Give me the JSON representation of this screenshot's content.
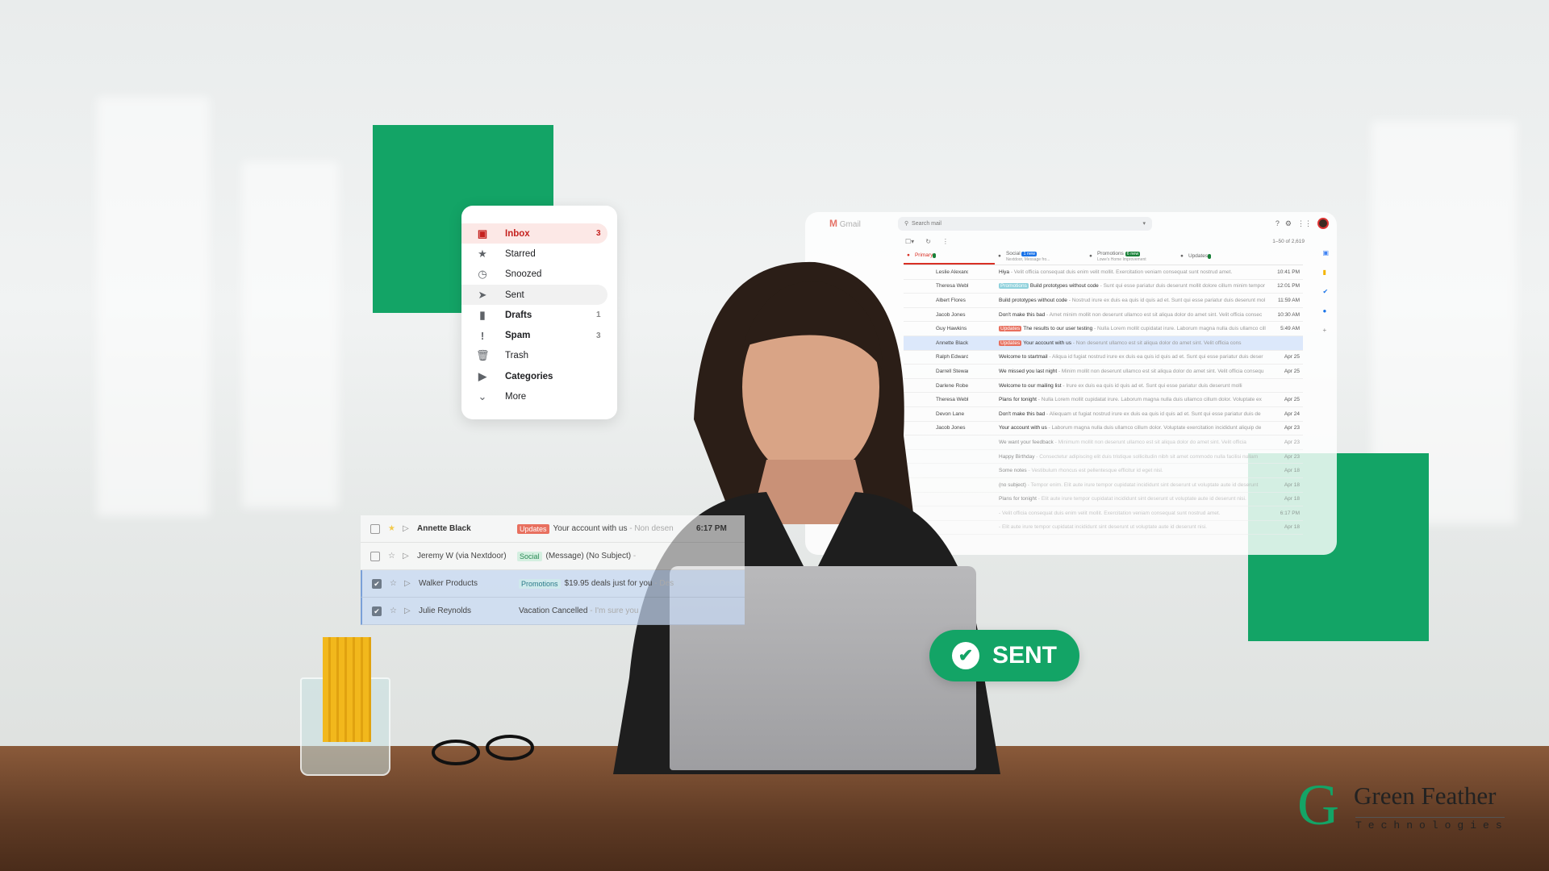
{
  "colors": {
    "brand_green": "#13a466",
    "inbox_red": "#c5221f"
  },
  "nav": {
    "items": [
      {
        "icon": "inbox-icon",
        "label": "Inbox",
        "count": "3"
      },
      {
        "icon": "star-icon",
        "label": "Starred",
        "count": ""
      },
      {
        "icon": "clock-icon",
        "label": "Snoozed",
        "count": ""
      },
      {
        "icon": "send-icon",
        "label": "Sent",
        "count": ""
      },
      {
        "icon": "draft-icon",
        "label": "Drafts",
        "count": "1"
      },
      {
        "icon": "spam-icon",
        "label": "Spam",
        "count": "3"
      },
      {
        "icon": "trash-icon",
        "label": "Trash",
        "count": ""
      },
      {
        "icon": "label-icon",
        "label": "Categories",
        "count": ""
      },
      {
        "icon": "chevron-down-icon",
        "label": "More",
        "count": ""
      }
    ]
  },
  "gmail": {
    "app_name": "Gmail",
    "search_placeholder": "Search mail",
    "pagination": "1–50 of 2,619",
    "tabs": [
      {
        "label": "Primary",
        "badge": "",
        "sub": ""
      },
      {
        "label": "Social",
        "badge": "1 new",
        "sub": "Nextdoor, Message fro..."
      },
      {
        "label": "Promotions",
        "badge": "6 new",
        "sub": "Lowe's Home Improvement"
      },
      {
        "label": "Updates",
        "badge": "",
        "sub": ""
      }
    ],
    "rows": [
      {
        "sender": "Leslie Alexander",
        "tag": "",
        "subject": "Hiya",
        "snippet": " - Velit officia consequat duis enim velit mollit. Exercitation veniam consequat sunt nostrud amet.",
        "time": "10:41 PM"
      },
      {
        "sender": "Theresa Webb",
        "tag": "Promotions",
        "subject": "Build prototypes without code",
        "snippet": " - Sunt qui esse pariatur duis deserunt mollit dolore cillum minim tempor",
        "time": "12:01 PM"
      },
      {
        "sender": "Albert Flores",
        "tag": "",
        "subject": "Build prototypes without code",
        "snippet": " - Nostrud irure ex duis ea quis id quis ad et. Sunt qui esse pariatur duis deserunt mol",
        "time": "11:59 AM"
      },
      {
        "sender": "Jacob Jones",
        "tag": "",
        "subject": "Don't make this bad",
        "snippet": " - Amet minim mollit non deserunt ullamco est sit aliqua dolor do amet sint. Velit officia consec",
        "time": "10:30 AM"
      },
      {
        "sender": "Guy Hawkins",
        "tag": "Updates",
        "subject": "The results to our user testing",
        "snippet": " - Nulla Lorem mollit cupidatat irure. Laborum magna nulla duis ullamco cill",
        "time": "5:49 AM"
      },
      {
        "sender": "Annette Black",
        "tag": "Updates",
        "subject": "Your account with us",
        "snippet": " - Non deserunt ullamco est sit aliqua dolor do amet sint. Velit officia cons",
        "time": ""
      },
      {
        "sender": "Ralph Edwards",
        "tag": "",
        "subject": "Welcome to startmail",
        "snippet": " - Aliqua id fugiat nostrud irure ex duis ea quis id quis ad et. Sunt qui esse pariatur duis deser",
        "time": "Apr 25"
      },
      {
        "sender": "Darrell Steward",
        "tag": "",
        "subject": "We missed you last night",
        "snippet": " - Minim mollit non deserunt ullamco est sit aliqua dolor do amet sint. Velit officia consequ",
        "time": "Apr 25"
      },
      {
        "sender": "Darlene Robertson",
        "tag": "",
        "subject": "Welcome to our mailing list",
        "snippet": " - Irure ex duis ea quis id quis ad et. Sunt qui esse pariatur duis deserunt molli",
        "time": ""
      },
      {
        "sender": "Theresa Webb",
        "tag": "",
        "subject": "Plans for tonight",
        "snippet": " - Nulla Lorem mollit cupidatat irure. Laborum magna nulla duis ullamco cillum dolor. Voluptate ex",
        "time": "Apr 25"
      },
      {
        "sender": "Devon Lane",
        "tag": "",
        "subject": "Don't make this bad",
        "snippet": " - Aliequam ut fugiat nostrud irure ex duis ea quis id quis ad et. Sunt qui esse pariatur duis de",
        "time": "Apr 24"
      },
      {
        "sender": "Jacob Jones",
        "tag": "",
        "subject": "Your account with us",
        "snippet": " - Laborum magna nulla duis ullamco cillum dolor. Voluptate exercitation incididunt aliquip de",
        "time": "Apr 23"
      },
      {
        "sender": "",
        "tag": "",
        "subject": "We want your feedback",
        "snippet": " - Minimum mollit non deserunt ullamco est sit aliqua dolor do amet sint. Velit officia",
        "time": "Apr 23"
      },
      {
        "sender": "",
        "tag": "",
        "subject": "Happy Birthday",
        "snippet": " - Consectetur adipiscing elit duis tristique sollicitudin nibh sit amet commodo nulla facilisi nullam",
        "time": "Apr 23"
      },
      {
        "sender": "",
        "tag": "",
        "subject": "Some notes",
        "snippet": " - Vestibulum rhoncus est pellentesque efficitur id eget nisl.",
        "time": "Apr 18"
      },
      {
        "sender": "",
        "tag": "",
        "subject": "(no subject)",
        "snippet": " - Tempor enim. Elit aute irure tempor cupidatat incididunt sint deserunt ut voluptate aute id deserunt",
        "time": "Apr 18"
      },
      {
        "sender": "",
        "tag": "",
        "subject": "Plans for tonight",
        "snippet": " - Elit aute irure tempor cupidatat incididunt sint deserunt ut voluptate aute id deserunt nisi.",
        "time": "Apr 18"
      },
      {
        "sender": "",
        "tag": "",
        "subject": "",
        "snippet": " - Velit officia consequat duis enim velit mollit. Exercitation veniam consequat sunt nostrud amet.",
        "time": "6:17 PM"
      },
      {
        "sender": "",
        "tag": "",
        "subject": "",
        "snippet": " - Elit aute irure tempor cupidatat incididunt sint deserunt ut voluptate aute id deserunt nisi.",
        "time": "Apr 18"
      }
    ]
  },
  "strip": {
    "rows": [
      {
        "sender": "Annette Black",
        "tag": "Updates",
        "subject": "Your account with us",
        "snippet": " - Non desen",
        "time": "6:17 PM"
      },
      {
        "sender": "Jeremy W (via Nextdoor)",
        "tag": "Social",
        "subject": "(Message) (No Subject)",
        "snippet": " -",
        "time": ""
      },
      {
        "sender": "Walker Products",
        "tag": "Promotions",
        "subject": "$19.95 deals just for you",
        "snippet": " - Des",
        "time": ""
      },
      {
        "sender": "Julie Reynolds",
        "tag": "",
        "subject": "Vacation Cancelled",
        "snippet": " - I'm sure you",
        "time": ""
      }
    ]
  },
  "sent_badge": {
    "label": "SENT"
  },
  "logo": {
    "name": "Green Feather",
    "tagline": "Technologies"
  }
}
